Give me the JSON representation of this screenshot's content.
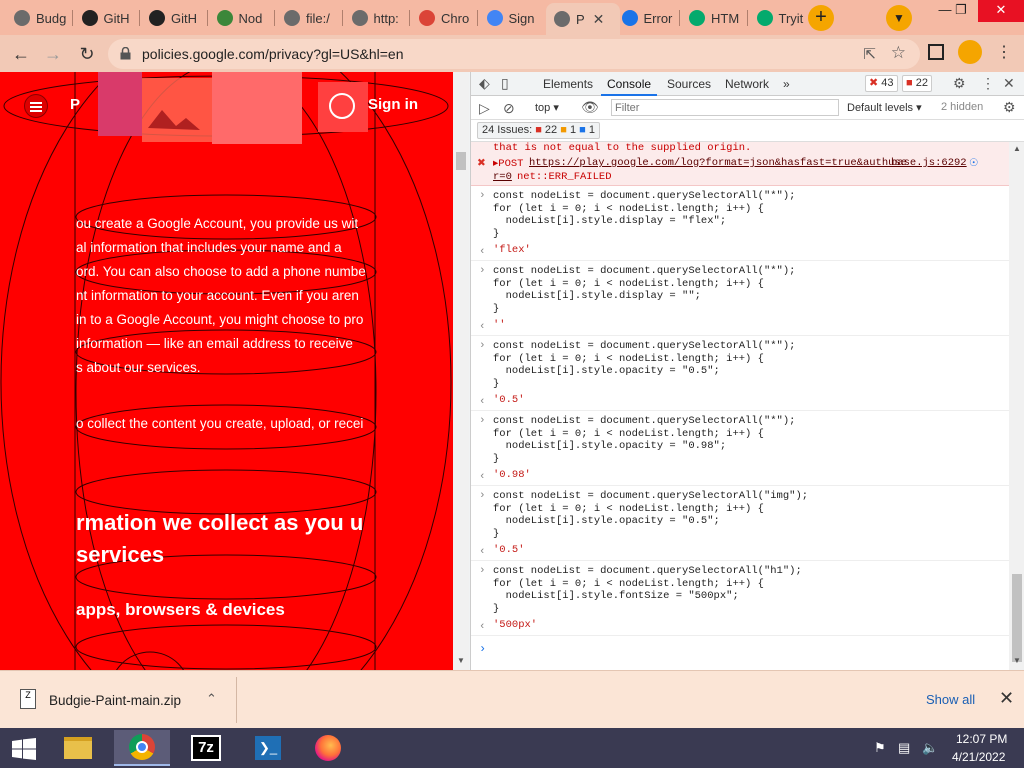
{
  "tabs": [
    {
      "label": "Budg",
      "icon": "globe-icon",
      "color": "#6b6b6b"
    },
    {
      "label": "GitH",
      "icon": "github-icon",
      "color": "#222222"
    },
    {
      "label": "GitH",
      "icon": "github-icon",
      "color": "#222222"
    },
    {
      "label": "Nod",
      "icon": "nodejs-icon",
      "color": "#3c873a"
    },
    {
      "label": "file:/",
      "icon": "globe-icon",
      "color": "#6b6b6b"
    },
    {
      "label": "http:",
      "icon": "globe-icon",
      "color": "#6b6b6b"
    },
    {
      "label": "Chro",
      "icon": "chrome-icon",
      "color": "#db4437"
    },
    {
      "label": "Sign",
      "icon": "google-icon",
      "color": "#4285f4"
    },
    {
      "label": "P",
      "icon": "globe-icon",
      "color": "#6b6b6b",
      "active": true
    },
    {
      "label": "Error",
      "icon": "play-icon",
      "color": "#1a73e8"
    },
    {
      "label": "HTM",
      "icon": "w3schools-icon",
      "color": "#04aa6d"
    },
    {
      "label": "Tryit",
      "icon": "w3schools-icon",
      "color": "#04aa6d"
    }
  ],
  "toolbar": {
    "url": "policies.google.com/privacy?gl=US&hl=en"
  },
  "page": {
    "sign_in": "Sign in",
    "logo_letter": "P",
    "lines": [
      "ou create a Google Account, you provide us wit",
      "al information that includes your name and a",
      "ord. You can also choose to add a phone numbe",
      "nt information to your account. Even if you aren",
      "in to a Google Account, you might choose to pro",
      "information — like an email address to receive",
      "s about our services."
    ],
    "line2": "o collect the content you create, upload, or recei",
    "heading1": "rmation we collect as you u",
    "heading2": "services",
    "subheading": "apps, browsers & devices"
  },
  "devtools": {
    "tabs": [
      "Elements",
      "Console",
      "Sources",
      "Network"
    ],
    "more_tabs": "»",
    "error_count": "43",
    "warning_count": "22",
    "context": "top",
    "filter_placeholder": "Filter",
    "levels": "Default levels ▾",
    "hidden": "2 hidden",
    "issues_label": "24 Issues:",
    "issues_errors": "22",
    "issues_warnings": "1",
    "issues_info": "1",
    "error_truncated": "that is not equal to the supplied origin.",
    "error_prefix": "▸POST",
    "error_url": "https://play.google.com/log?format=json&hasfast=true&authuse",
    "error_url_cont": "r=0",
    "error_msg": "net::ERR_FAILED",
    "error_source": "base.js:6292",
    "entries": [
      {
        "code": "const nodeList = document.querySelectorAll(\"*\");\nfor (let i = 0; i < nodeList.length; i++) {\n  nodeList[i].style.display = \"flex\";\n}",
        "result": "'flex'"
      },
      {
        "code": "const nodeList = document.querySelectorAll(\"*\");\nfor (let i = 0; i < nodeList.length; i++) {\n  nodeList[i].style.display = \"\";\n}",
        "result": "''"
      },
      {
        "code": "const nodeList = document.querySelectorAll(\"*\");\nfor (let i = 0; i < nodeList.length; i++) {\n  nodeList[i].style.opacity = \"0.5\";\n}",
        "result": "'0.5'"
      },
      {
        "code": "const nodeList = document.querySelectorAll(\"*\");\nfor (let i = 0; i < nodeList.length; i++) {\n  nodeList[i].style.opacity = \"0.98\";\n}",
        "result": "'0.98'"
      },
      {
        "code": "const nodeList = document.querySelectorAll(\"img\");\nfor (let i = 0; i < nodeList.length; i++) {\n  nodeList[i].style.opacity = \"0.5\";\n}",
        "result": "'0.5'"
      },
      {
        "code": "const nodeList = document.querySelectorAll(\"h1\");\nfor (let i = 0; i < nodeList.length; i++) {\n  nodeList[i].style.fontSize = \"500px\";\n}",
        "result": "'500px'"
      }
    ],
    "prompt": "›"
  },
  "downloads": {
    "file_name": "Budgie-Paint-main.zip",
    "show_all": "Show all"
  },
  "taskbar": {
    "time": "12:07 PM",
    "date": "4/21/2022",
    "apps": [
      "file-explorer-icon",
      "chrome-icon",
      "7zip-icon",
      "powershell-icon",
      "firefox-icon"
    ]
  },
  "colors": {
    "page_bg": "#ff0000",
    "tabstrip_bg": "#f5b9a3",
    "accent": "#f5a500",
    "taskbar_bg": "#3a3a52"
  }
}
